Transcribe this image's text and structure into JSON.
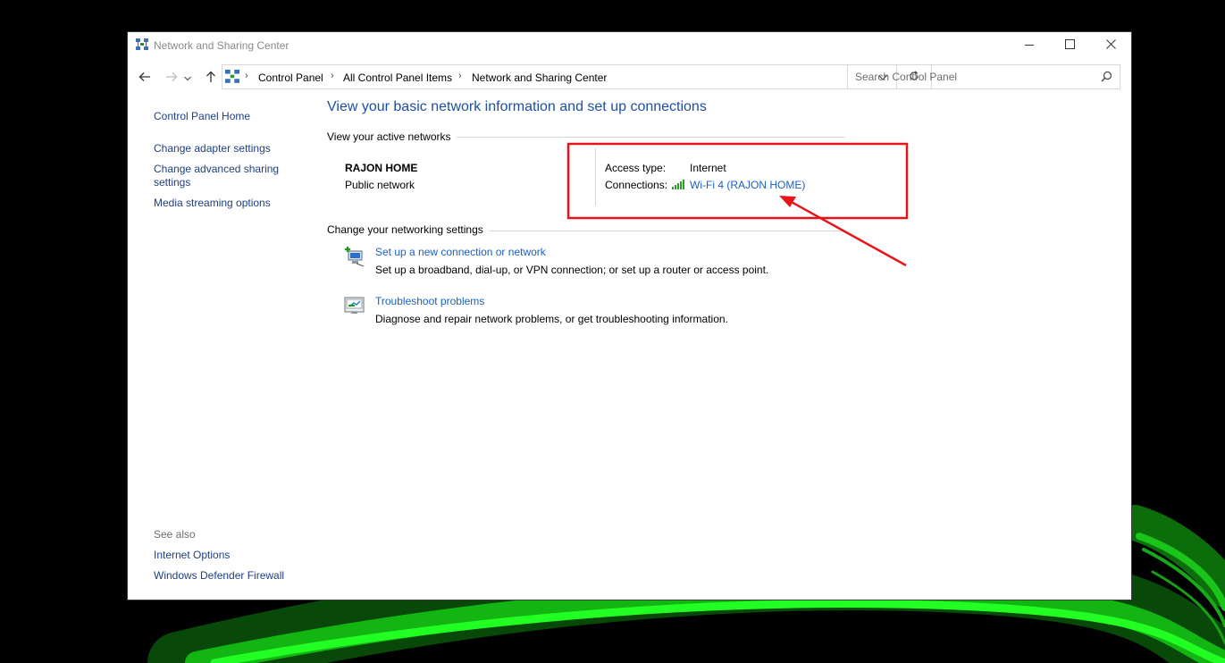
{
  "window": {
    "title": "Network and Sharing Center",
    "icon": "network-center-icon"
  },
  "caption_buttons": {
    "minimize": "minimize-icon",
    "maximize": "maximize-icon",
    "close": "close-icon"
  },
  "navigation": {
    "back": "back-arrow-icon",
    "forward": "forward-arrow-icon",
    "recent": "chevron-down-icon",
    "up": "up-arrow-icon"
  },
  "address_bar": {
    "breadcrumbs": [
      {
        "label": "Control Panel"
      },
      {
        "label": "All Control Panel Items"
      },
      {
        "label": "Network and Sharing Center"
      }
    ],
    "refresh": "refresh-icon"
  },
  "search": {
    "placeholder": "Search Control Panel",
    "value": ""
  },
  "sidebar": {
    "items": [
      {
        "label": "Control Panel Home"
      },
      {
        "label": "Change adapter settings"
      },
      {
        "label": "Change advanced sharing settings"
      },
      {
        "label": "Media streaming options"
      }
    ],
    "see_also_title": "See also",
    "see_also": [
      {
        "label": "Internet Options"
      },
      {
        "label": "Windows Defender Firewall"
      }
    ]
  },
  "main": {
    "heading": "View your basic network information and set up connections",
    "active_networks": {
      "section_title": "View your active networks",
      "network_name": "RAJON HOME",
      "network_category": "Public network",
      "access_type_label": "Access type:",
      "access_type_value": "Internet",
      "connections_label": "Connections:",
      "connection_link": "Wi-Fi 4 (RAJON HOME)"
    },
    "settings": {
      "section_title": "Change your networking settings",
      "tasks": [
        {
          "title": "Set up a new connection or network",
          "description": "Set up a broadband, dial-up, or VPN connection; or set up a router or access point.",
          "icon": "new-connection-icon"
        },
        {
          "title": "Troubleshoot problems",
          "description": "Diagnose and repair network problems, or get troubleshooting information.",
          "icon": "troubleshoot-icon"
        }
      ]
    }
  },
  "colors": {
    "link": "#1e5fbf",
    "heading": "#1e4fa0",
    "annotation": "#e8141c",
    "wallpaper_glow": "#22ff22"
  }
}
